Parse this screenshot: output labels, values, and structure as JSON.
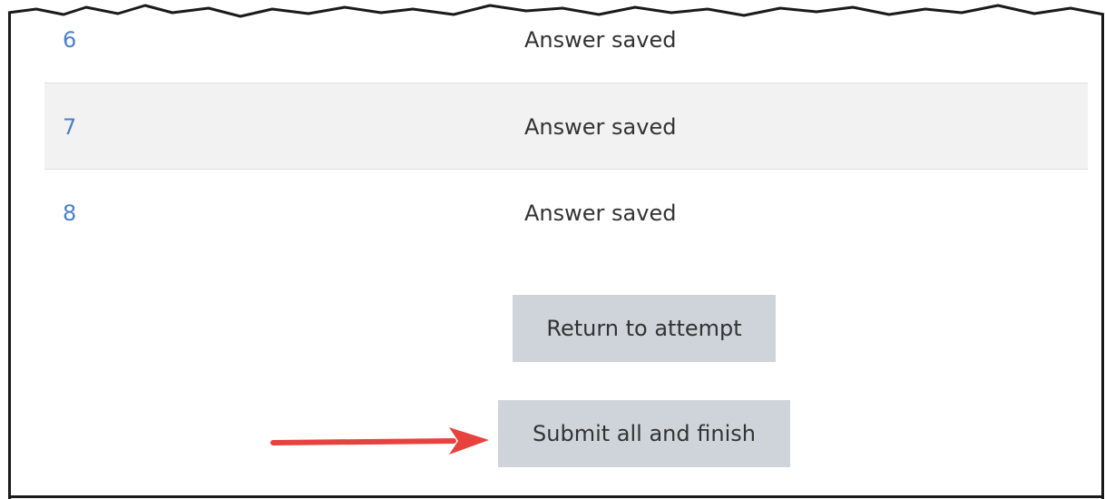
{
  "quiz_summary": {
    "rows": [
      {
        "question": "6",
        "status": "Answer saved"
      },
      {
        "question": "7",
        "status": "Answer saved"
      },
      {
        "question": "8",
        "status": "Answer saved"
      }
    ]
  },
  "actions": {
    "return_label": "Return to attempt",
    "submit_label": "Submit all and finish"
  },
  "annotation": {
    "arrow_color": "#e8423f"
  },
  "colors": {
    "link": "#4a80c8",
    "button_bg": "#ced4da",
    "row_shade": "#f2f2f2"
  }
}
